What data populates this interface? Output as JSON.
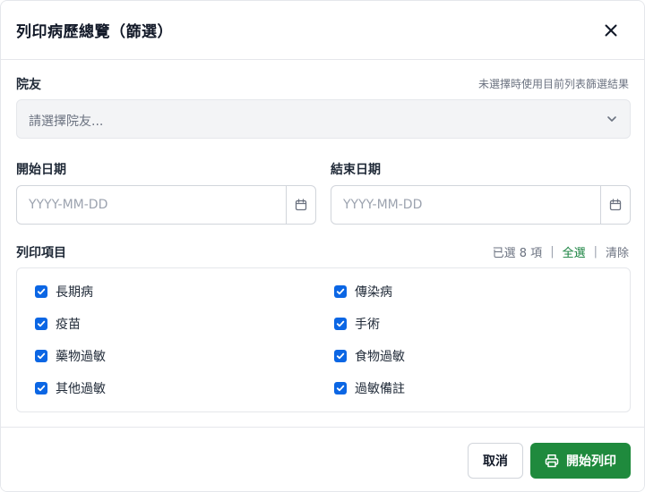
{
  "dialog": {
    "title": "列印病歷總覽（篩選）",
    "close_icon": "close-icon"
  },
  "resident": {
    "label": "院友",
    "hint": "未選擇時使用目前列表篩選結果",
    "placeholder": "請選擇院友..."
  },
  "start_date": {
    "label": "開始日期",
    "placeholder": "YYYY-MM-DD"
  },
  "end_date": {
    "label": "結束日期",
    "placeholder": "YYYY-MM-DD"
  },
  "print_items": {
    "label": "列印項目",
    "selected_count": "已選 8 項",
    "select_all": "全選",
    "clear": "清除",
    "items": [
      {
        "label": "長期病",
        "checked": true
      },
      {
        "label": "傳染病",
        "checked": true
      },
      {
        "label": "疫苗",
        "checked": true
      },
      {
        "label": "手術",
        "checked": true
      },
      {
        "label": "藥物過敏",
        "checked": true
      },
      {
        "label": "食物過敏",
        "checked": true
      },
      {
        "label": "其他過敏",
        "checked": true
      },
      {
        "label": "過敏備註",
        "checked": true
      }
    ]
  },
  "footer": {
    "cancel_label": "取消",
    "print_label": "開始列印",
    "print_icon": "printer-icon"
  },
  "colors": {
    "accent_green": "#1f8a3d",
    "checkbox_blue": "#0b66e4",
    "link_green": "#15803d"
  }
}
